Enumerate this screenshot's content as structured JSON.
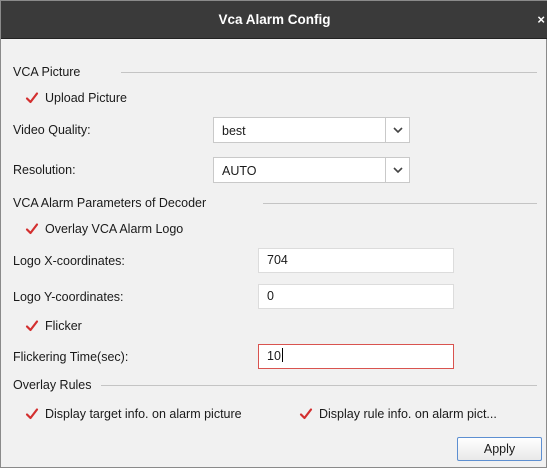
{
  "window": {
    "title": "Vca Alarm Config",
    "close_glyph": "×"
  },
  "vca_picture": {
    "header": "VCA Picture",
    "upload_picture": {
      "label": "Upload Picture",
      "checked": true
    },
    "video_quality": {
      "label": "Video Quality:",
      "value": "best"
    },
    "resolution": {
      "label": "Resolution:",
      "value": "AUTO"
    }
  },
  "decoder": {
    "header": "VCA Alarm Parameters of Decoder",
    "overlay_logo": {
      "label": "Overlay VCA Alarm Logo",
      "checked": true
    },
    "logo_x": {
      "label": "Logo X-coordinates:",
      "value": "704"
    },
    "logo_y": {
      "label": "Logo Y-coordinates:",
      "value": "0"
    },
    "flicker": {
      "label": "Flicker",
      "checked": true
    },
    "flicker_time": {
      "label": "Flickering Time(sec):",
      "value": "10"
    }
  },
  "overlay_rules": {
    "header": "Overlay Rules",
    "target_info": {
      "label": "Display target info. on alarm picture",
      "checked": true
    },
    "rule_info": {
      "label": "Display rule info. on alarm pict...",
      "checked": true
    }
  },
  "footer": {
    "apply_label": "Apply"
  },
  "colors": {
    "titlebar": "#3a3a3a",
    "checkmark": "#d32f2f",
    "focus_border": "#d9534f",
    "button_border": "#5d8fd1"
  },
  "icons": {
    "checkbox_checked": "checkmark-icon",
    "dropdown": "chevron-down-icon",
    "close": "close-icon"
  }
}
